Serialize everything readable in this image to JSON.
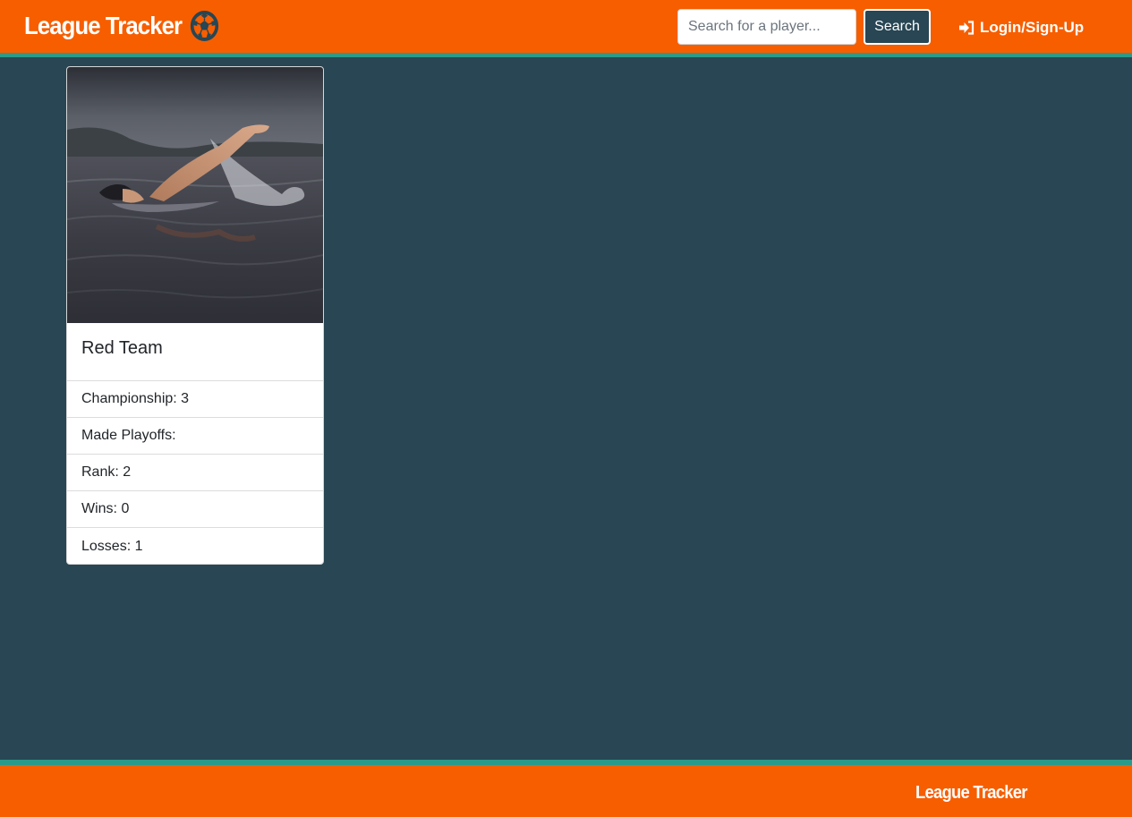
{
  "header": {
    "brand": "League Tracker",
    "brand_icon": "soccer-ball-icon",
    "search_placeholder": "Search for a player...",
    "search_button": "Search",
    "login_label": "Login/Sign-Up",
    "login_icon": "sign-in-icon"
  },
  "team_card": {
    "image": "swimmer-photo",
    "name": "Red Team",
    "stats": [
      "Championship: 3",
      "Made Playoffs:",
      "Rank: 2",
      "Wins: 0",
      "Losses: 1"
    ]
  },
  "footer": {
    "brand": "League Tracker"
  },
  "colors": {
    "header_bg": "#f75e00",
    "accent_stripe": "#2a9a8b",
    "page_bg": "#284654",
    "search_button_bg": "#284654"
  }
}
